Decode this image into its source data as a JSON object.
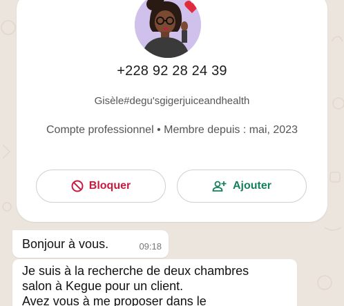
{
  "contact": {
    "phone": "+228 92 28 24 39",
    "business_name": "Gisèle#degu'sgigerjuiceandhealth",
    "account_info": "Compte professionnel • Membre depuis : mai, 2023"
  },
  "actions": {
    "block_label": "Bloquer",
    "add_label": "Ajouter"
  },
  "messages": [
    {
      "text": "Bonjour à vous.",
      "time": "09:18"
    },
    {
      "lines": [
        "Je suis à la recherche de deux chambres",
        "salon à Kegue pour un client.",
        "Avez vous à me proposer dans le"
      ]
    }
  ],
  "colors": {
    "block": "#c8193f",
    "add": "#16805a",
    "background": "#ece5dd"
  },
  "icons": [
    "block-icon",
    "add-contact-icon",
    "heart-icon"
  ]
}
